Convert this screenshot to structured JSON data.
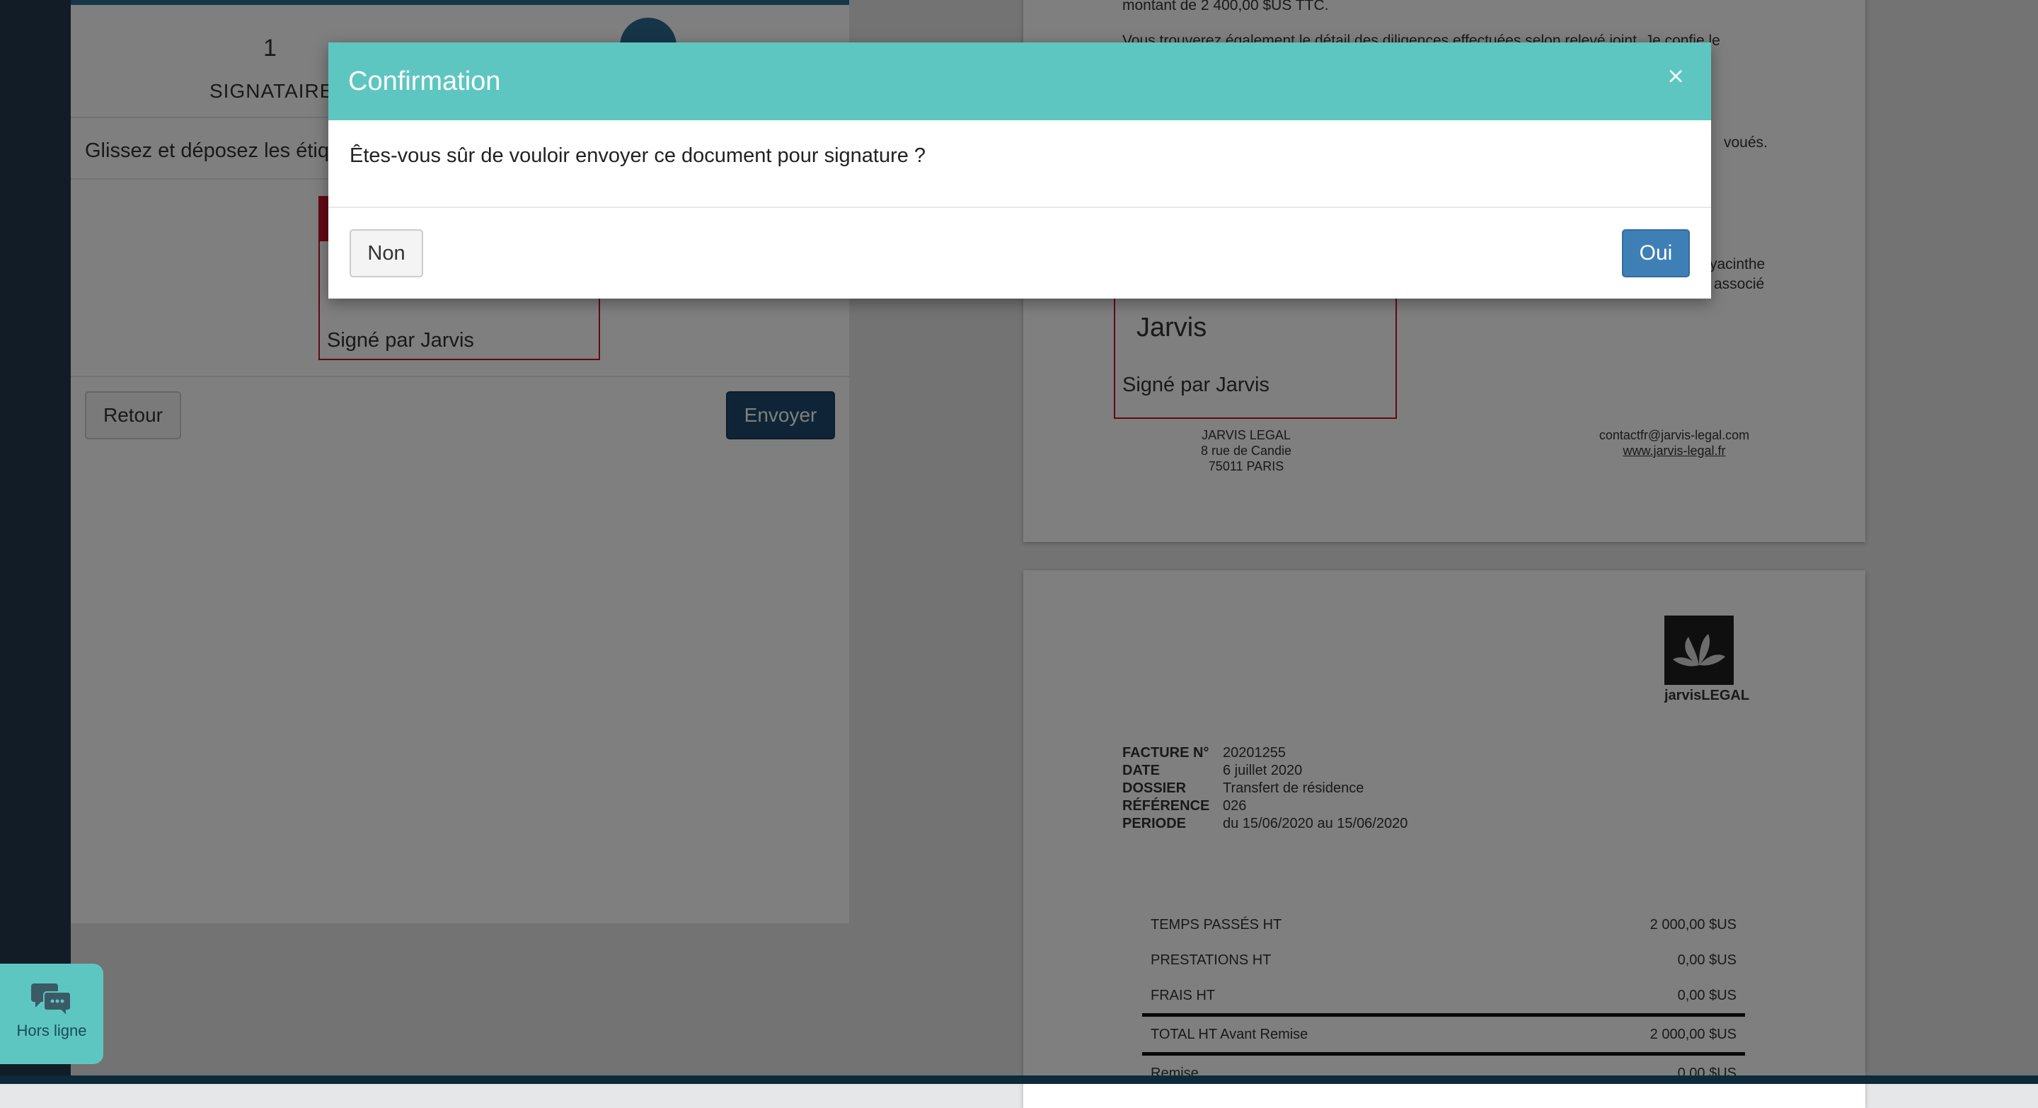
{
  "wizard": {
    "step_number": "1",
    "step_label": "SIGNATAIRES",
    "instruction": "Glissez et déposez les étiqu",
    "signature_label": "Signé par Jarvis",
    "back_button": "Retour",
    "send_button": "Envoyer"
  },
  "document_page1": {
    "line1": "montant de 2 400,00 $US TTC.",
    "line2": "Vous trouverez également le détail des diligences effectuées selon relevé joint. Je confie le",
    "line3": "voués.",
    "line4": "yacinthe",
    "line5": "associé",
    "signature_name": "Jarvis",
    "signature_label": "Signé par Jarvis",
    "address": [
      "JARVIS LEGAL",
      "8 rue de Candie",
      "75011 PARIS"
    ],
    "contact_email": "contactfr@jarvis-legal.com",
    "contact_site": "www.jarvis-legal.fr"
  },
  "document_page2": {
    "logo_text": "jarvisLEGAL",
    "meta": [
      {
        "key": "FACTURE N°",
        "value": "20201255"
      },
      {
        "key": "DATE",
        "value": "6 juillet 2020"
      },
      {
        "key": "DOSSIER",
        "value": "Transfert de résidence"
      },
      {
        "key": "RÉFÉRENCE",
        "value": "026"
      },
      {
        "key": "PERIODE",
        "value": "du 15/06/2020 au 15/06/2020"
      }
    ],
    "rows": [
      {
        "label": "TEMPS PASSÉS HT",
        "amount": "2 000,00 $US"
      },
      {
        "label": "PRESTATIONS HT",
        "amount": "0,00 $US"
      },
      {
        "label": "FRAIS HT",
        "amount": "0,00 $US"
      },
      {
        "label": "TOTAL HT Avant Remise",
        "amount": "2 000,00 $US"
      },
      {
        "label": "Remise",
        "amount": "0,00 $US"
      }
    ]
  },
  "modal": {
    "title": "Confirmation",
    "close_symbol": "×",
    "message": "Êtes-vous sûr de vouloir envoyer ce document pour signature ?",
    "no_button": "Non",
    "yes_button": "Oui"
  },
  "chat_widget": {
    "label": "Hors ligne",
    "icon": "chat-bubbles-icon"
  },
  "colors": {
    "modal_header": "#5ec6c1",
    "primary_button": "#3e7fb6",
    "send_button": "#1e4a6e",
    "signature_border": "#c8102e"
  }
}
